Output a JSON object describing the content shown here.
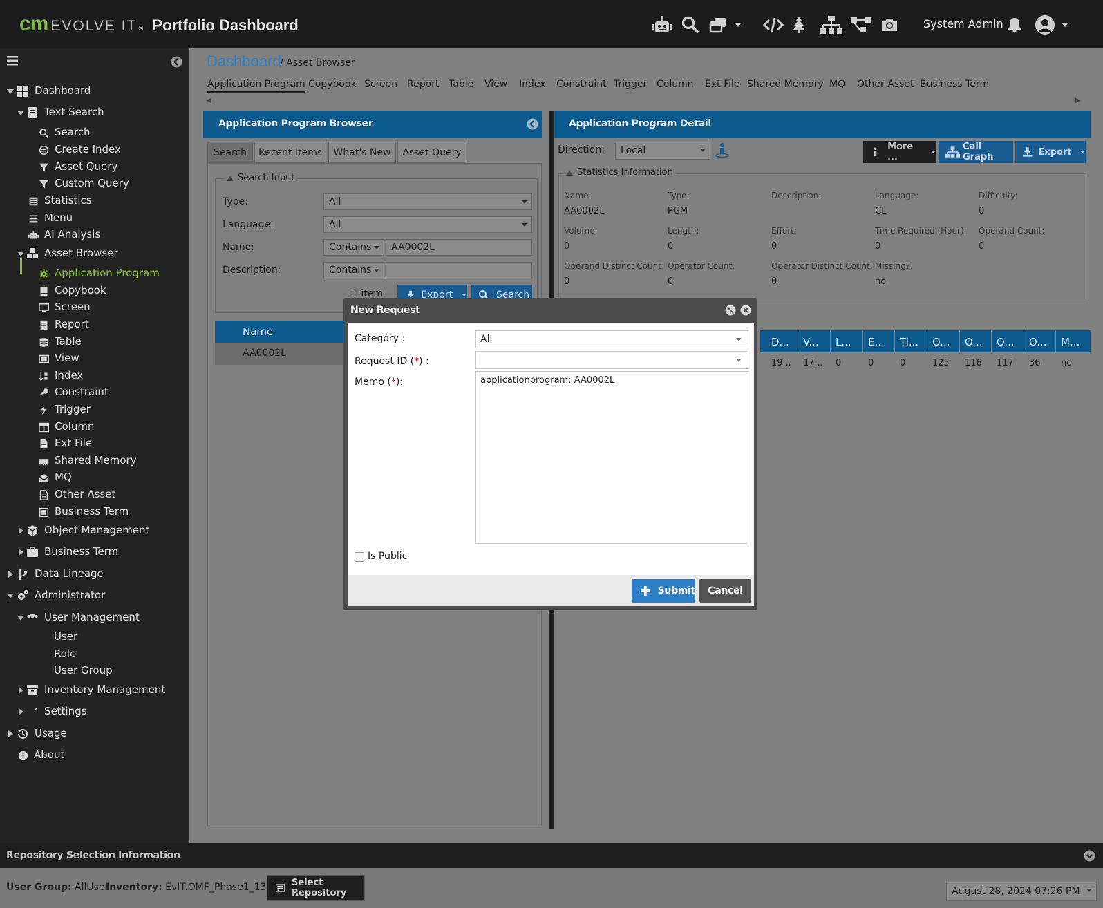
{
  "header": {
    "logo_cm": "cm",
    "logo_evolve": "EVOLVE IT",
    "logo_reg": "®",
    "title": "Portfolio Dashboard",
    "user": "System Admin"
  },
  "sidebar": {
    "items": [
      {
        "label": "Dashboard",
        "icon": "dashboard-grid-icon"
      },
      {
        "label": "Text Search",
        "icon": "document-icon"
      },
      {
        "label": "Search",
        "icon": "search-icon"
      },
      {
        "label": "Create Index",
        "icon": "create-index-icon"
      },
      {
        "label": "Asset Query",
        "icon": "filter-icon"
      },
      {
        "label": "Custom Query",
        "icon": "filter-icon"
      },
      {
        "label": "Statistics",
        "icon": "statistics-icon"
      },
      {
        "label": "Menu",
        "icon": "menu-icon"
      },
      {
        "label": "AI Analysis",
        "icon": "robot-icon"
      },
      {
        "label": "Asset Browser",
        "icon": "cubes-icon"
      },
      {
        "label": "Application Program",
        "icon": "gear-icon"
      },
      {
        "label": "Copybook",
        "icon": "book-icon"
      },
      {
        "label": "Screen",
        "icon": "monitor-icon"
      },
      {
        "label": "Report",
        "icon": "report-icon"
      },
      {
        "label": "Table",
        "icon": "database-icon"
      },
      {
        "label": "View",
        "icon": "view-icon"
      },
      {
        "label": "Index",
        "icon": "sort-icon"
      },
      {
        "label": "Constraint",
        "icon": "key-icon"
      },
      {
        "label": "Trigger",
        "icon": "bolt-icon"
      },
      {
        "label": "Column",
        "icon": "columns-icon"
      },
      {
        "label": "Ext File",
        "icon": "file-icon"
      },
      {
        "label": "Shared Memory",
        "icon": "memory-icon"
      },
      {
        "label": "MQ",
        "icon": "mq-icon"
      },
      {
        "label": "Other Asset",
        "icon": "file-text-icon"
      },
      {
        "label": "Business Term",
        "icon": "business-term-icon"
      },
      {
        "label": "Object Management",
        "icon": "cube-icon"
      },
      {
        "label": "Business Term",
        "icon": "briefcase-icon"
      },
      {
        "label": "Data Lineage",
        "icon": "branch-icon"
      },
      {
        "label": "Administrator",
        "icon": "gears-icon"
      },
      {
        "label": "User Management",
        "icon": "users-icon"
      },
      {
        "label": "User",
        "icon": ""
      },
      {
        "label": "Role",
        "icon": ""
      },
      {
        "label": "User Group",
        "icon": ""
      },
      {
        "label": "Inventory Management",
        "icon": "archive-icon"
      },
      {
        "label": "Settings",
        "icon": "wrench-icon"
      },
      {
        "label": "Usage",
        "icon": "history-icon"
      },
      {
        "label": "About",
        "icon": "info-icon"
      }
    ]
  },
  "breadcrumb": {
    "root": "Dashboard",
    "current": "/ Asset Browser"
  },
  "asset_tabs": [
    "Application Program",
    "Copybook",
    "Screen",
    "Report",
    "Table",
    "View",
    "Index",
    "Constraint",
    "Trigger",
    "Column",
    "Ext File",
    "Shared Memory",
    "MQ",
    "Other Asset",
    "Business Term"
  ],
  "browser": {
    "title": "Application Program Browser",
    "tabs": [
      "Search",
      "Recent Items",
      "What's New",
      "Asset Query"
    ],
    "search_input_legend": "Search Input",
    "type_label": "Type:",
    "type_value": "All",
    "language_label": "Language:",
    "language_value": "All",
    "name_label": "Name:",
    "name_op": "Contains",
    "name_value": "AA0002L",
    "desc_label": "Description:",
    "desc_op": "Contains",
    "desc_value": "",
    "items_count": "1 item",
    "export_label": "Export",
    "search_label": "Search",
    "grid_header": "Name",
    "grid_row": "AA0002L"
  },
  "detail": {
    "title": "Application Program Detail",
    "direction_label": "Direction:",
    "direction_value": "Local",
    "more_label": "More ...",
    "callgraph_label": "Call Graph",
    "export_label": "Export",
    "stats_legend": "Statistics Information",
    "stats": [
      {
        "label": "Name:",
        "value": "AA0002L"
      },
      {
        "label": "Type:",
        "value": "PGM"
      },
      {
        "label": "Description:",
        "value": ""
      },
      {
        "label": "Language:",
        "value": "CL"
      },
      {
        "label": "Difficulty:",
        "value": "0"
      },
      {
        "label": "Volume:",
        "value": "0"
      },
      {
        "label": "Length:",
        "value": "0"
      },
      {
        "label": "Effort:",
        "value": "0"
      },
      {
        "label": "Time Required (Hour):",
        "value": "0"
      },
      {
        "label": "Operand Count:",
        "value": "0"
      },
      {
        "label": "Operand Distinct Count:",
        "value": "0"
      },
      {
        "label": "Operator Count:",
        "value": "0"
      },
      {
        "label": "Operator Distinct Count:",
        "value": "0"
      },
      {
        "label": "Missing?:",
        "value": "no"
      }
    ],
    "grid_headers": [
      "D...",
      "V...",
      "L...",
      "E...",
      "Ti...",
      "O...",
      "O...",
      "O...",
      "O...",
      "M..."
    ],
    "grid_values": [
      "19...",
      "17...",
      "0",
      "0",
      "0",
      "125",
      "116",
      "117",
      "36",
      "no"
    ]
  },
  "footer": {
    "title": "Repository Selection Information",
    "user_group_label": "User Group:",
    "user_group_value": "AllUser",
    "inventory_label": "Inventory:",
    "inventory_value": "EvIT.OMF_Phase1_13",
    "select_repo_label": "Select Repository",
    "datetime": "August 28, 2024 07:26 PM"
  },
  "dialog": {
    "title": "New Request",
    "category_label": "Category :",
    "category_value": "All",
    "request_id_label_pre": "Request ID (",
    "request_id_label_post": ") :",
    "request_id_value": "",
    "memo_label_pre": "Memo (",
    "memo_label_post": "):",
    "required_mark": "*",
    "memo_value": "applicationprogram: AA0002L",
    "is_public_label": "Is Public",
    "submit_label": "Submit",
    "cancel_label": "Cancel"
  },
  "colors": {
    "accent_blue": "#0d5a8f",
    "link_blue": "#2a7fc4",
    "active_green": "#8bc34a",
    "submit_blue": "#2f80c7",
    "required_red": "#d01818"
  }
}
